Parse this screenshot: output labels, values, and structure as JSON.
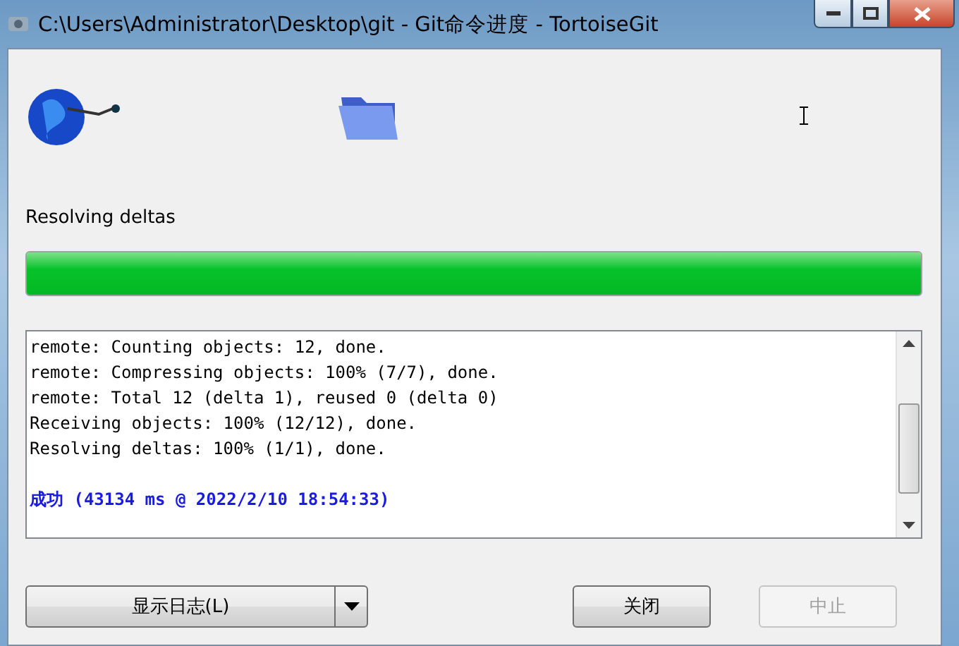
{
  "window": {
    "title": "C:\\Users\\Administrator\\Desktop\\git - Git命令进度 - TortoiseGit"
  },
  "status": "Resolving deltas",
  "progress": {
    "level": 1
  },
  "log": [
    {
      "kind": "normal",
      "text": "remote: Counting objects: 12, done."
    },
    {
      "kind": "normal",
      "text": "remote: Compressing objects: 100% (7/7), done."
    },
    {
      "kind": "normal",
      "text": "remote: Total 12 (delta 1), reused 0 (delta 0)"
    },
    {
      "kind": "normal",
      "text": "Receiving objects: 100% (12/12), done."
    },
    {
      "kind": "normal",
      "text": "Resolving deltas: 100% (1/1), done."
    },
    {
      "kind": "success",
      "text": "成功 (43134 ms @ 2022/2/10 18:54:33)"
    }
  ],
  "buttons": [
    {
      "kind": "split",
      "label": "显示日志(L)",
      "disabled": false
    },
    {
      "kind": "plain",
      "label": "关闭",
      "disabled": false
    },
    {
      "kind": "plain",
      "label": "中止",
      "disabled": true
    }
  ]
}
